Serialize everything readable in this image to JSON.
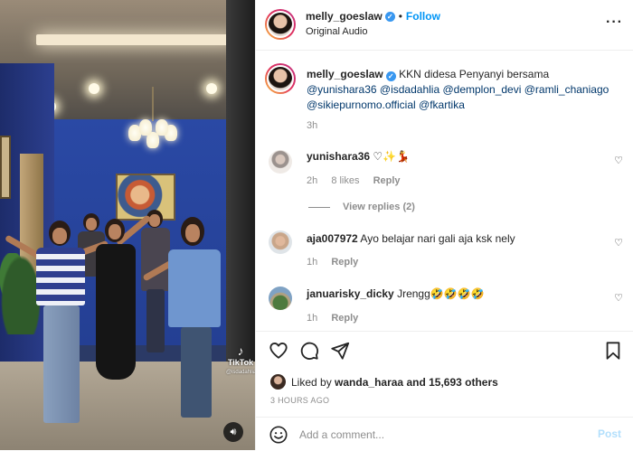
{
  "header": {
    "username": "melly_goeslaw",
    "follow_label": "Follow",
    "audio": "Original Audio",
    "more_icon": "more-horizontal-icon"
  },
  "caption": {
    "username": "melly_goeslaw",
    "text_before": "KKN didesa Penyanyi bersama",
    "mentions": [
      "@yunishara36",
      "@isdadahlia",
      "@demplon_devi",
      "@ramli_chaniago",
      "@sikiepurnomo.official",
      "@fkartika"
    ],
    "time": "3h"
  },
  "comments": [
    {
      "username": "yunishara36",
      "text": "♡✨💃",
      "time": "2h",
      "likes": "8 likes",
      "reply": "Reply",
      "view_replies": "View replies (2)"
    },
    {
      "username": "aja007972",
      "text": "Ayo belajar nari gali aja ksk nely",
      "time": "1h",
      "reply": "Reply"
    },
    {
      "username": "januarisky_dicky",
      "text": "Jrengg🤣🤣🤣🤣",
      "time": "1h",
      "reply": "Reply"
    }
  ],
  "actions": {
    "icons": [
      "heart-icon",
      "comment-icon",
      "share-icon",
      "bookmark-icon"
    ],
    "liked_prefix": "Liked by",
    "liked_user": "wanda_haraa",
    "liked_suffix": "and 15,693 others",
    "timestamp": "3 HOURS AGO"
  },
  "add_comment": {
    "placeholder": "Add a comment...",
    "post_label": "Post"
  },
  "video": {
    "watermark": "TikTok",
    "handle": "@isdadahlia"
  },
  "colors": {
    "accent": "#0095f6",
    "verified": "#3897f0",
    "muted": "#8e8e8e",
    "post_disabled": "#b2dffc"
  }
}
